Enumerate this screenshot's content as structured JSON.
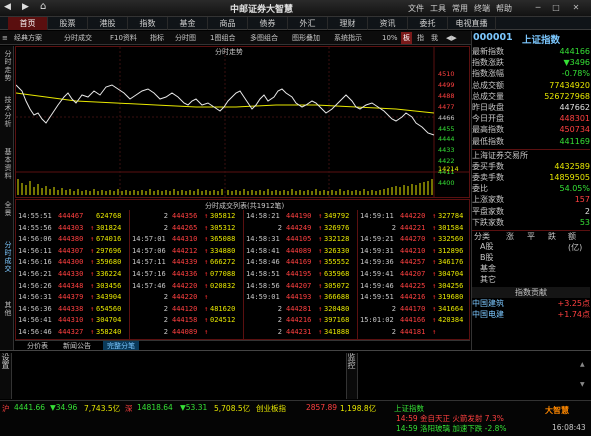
{
  "app": {
    "title": "中邮证券大智慧",
    "menus": [
      "文件",
      "工具",
      "常用",
      "终端",
      "帮助"
    ]
  },
  "navbar": {
    "tabs": [
      "首页",
      "股票",
      "港股",
      "指数",
      "基金",
      "商品",
      "债券",
      "外汇",
      "理财",
      "资讯",
      "委托",
      "电视直播"
    ]
  },
  "toolbar": {
    "items": [
      "经典方案",
      "分时成交",
      "F10资料",
      "指标",
      "分时图",
      "1图组合",
      "多图组合",
      "图形叠加",
      "系统指示",
      "10%"
    ],
    "toggles": [
      "板",
      "指",
      "我"
    ]
  },
  "lefttabs": [
    "分时走势",
    "技术分析",
    "基本资料",
    "全景",
    "分时成交",
    "其他"
  ],
  "chart": {
    "title": "分时走势",
    "price_labels": [
      "4510",
      "4499",
      "4488",
      "4477",
      "4466",
      "4455",
      "4444",
      "4433",
      "4422",
      "4411",
      "4400"
    ],
    "vol_label": "14214"
  },
  "trades": {
    "title": "分时成交列表(共1912笔)",
    "columns": [
      {
        "rows": [
          [
            "14:55:51",
            "444467",
            "624768",
            ""
          ],
          [
            "14:55:56",
            "444303",
            "301824",
            "up"
          ],
          [
            "14:56:06",
            "444380",
            "674016",
            "up"
          ],
          [
            "14:56:11",
            "444307",
            "297696",
            "up"
          ],
          [
            "14:56:16",
            "444300",
            "359680",
            "up"
          ],
          [
            "14:56:21",
            "444330",
            "336224",
            "up"
          ],
          [
            "14:56:26",
            "444348",
            "303456",
            "up"
          ],
          [
            "14:56:31",
            "444379",
            "343904",
            "up"
          ],
          [
            "14:56:36",
            "444338",
            "654560",
            "up"
          ],
          [
            "14:56:41",
            "444310",
            "304704",
            "up"
          ],
          [
            "14:56:46",
            "444327",
            "358240",
            "up"
          ]
        ]
      },
      {
        "rows": [
          [
            "2",
            "444356",
            "305812",
            "up"
          ],
          [
            "2",
            "444265",
            "305312",
            "up"
          ],
          [
            "14:57:01",
            "444310",
            "365088",
            "up"
          ],
          [
            "14:57:06",
            "444212",
            "334880",
            "up"
          ],
          [
            "14:57:11",
            "444339",
            "666272",
            "up"
          ],
          [
            "14:57:16",
            "444336",
            "077088",
            "up"
          ],
          [
            "14:57:46",
            "444220",
            "020832",
            "up"
          ],
          [
            "2",
            "444220",
            "",
            "up"
          ],
          [
            "2",
            "444120",
            "481620",
            "up"
          ],
          [
            "2",
            "444158",
            "024512",
            "up"
          ],
          [
            "2",
            "444089",
            "",
            "up"
          ]
        ]
      },
      {
        "rows": [
          [
            "14:58:21",
            "444190",
            "349792",
            "up"
          ],
          [
            "2",
            "444249",
            "326976",
            "up"
          ],
          [
            "14:58:31",
            "444105",
            "332128",
            "up"
          ],
          [
            "14:58:41",
            "444089",
            "326330",
            "up"
          ],
          [
            "14:58:46",
            "444169",
            "355552",
            "up"
          ],
          [
            "14:58:51",
            "444195",
            "635968",
            "up"
          ],
          [
            "14:58:56",
            "444207",
            "305072",
            "up"
          ],
          [
            "14:59:01",
            "444193",
            "366688",
            "up"
          ],
          [
            "2",
            "444281",
            "320480",
            "up"
          ],
          [
            "2",
            "444216",
            "397168",
            "up"
          ],
          [
            "2",
            "444231",
            "341888",
            "up"
          ]
        ]
      },
      {
        "rows": [
          [
            "14:59:11",
            "444220",
            "327784",
            "up"
          ],
          [
            "2",
            "444221",
            "301584",
            "up"
          ],
          [
            "14:59:21",
            "444270",
            "332560",
            "up"
          ],
          [
            "14:59:31",
            "444210",
            "312896",
            "up"
          ],
          [
            "14:59:36",
            "444257",
            "346176",
            "up"
          ],
          [
            "14:59:41",
            "444207",
            "304704",
            "up"
          ],
          [
            "14:59:46",
            "444225",
            "304256",
            "up"
          ],
          [
            "14:59:51",
            "444216",
            "319680",
            "up"
          ],
          [
            "2",
            "444170",
            "341664",
            "up"
          ],
          [
            "15:01:02",
            "444166",
            "420384",
            "up"
          ],
          [
            "2",
            "444181",
            "",
            "up"
          ]
        ]
      }
    ]
  },
  "bottomtabs": [
    "分价表",
    "新闻公告",
    "完整分笔"
  ],
  "quote": {
    "code": "000001",
    "name": "上证指数",
    "rows": [
      {
        "label": "最新指数",
        "value": "444166",
        "color": "#35e035"
      },
      {
        "label": "指数涨跌",
        "value": "▼3496",
        "color": "#35e035"
      },
      {
        "label": "指数涨幅",
        "value": "-0.78%",
        "color": "#35e035"
      },
      {
        "label": "总成交额",
        "value": "77434920",
        "color": "#e8e800"
      },
      {
        "label": "总成交量",
        "value": "526727968",
        "color": "#e8e800"
      },
      {
        "label": "昨日收盘",
        "value": "447662",
        "color": "#e0e0e0"
      },
      {
        "label": "今日开盘",
        "value": "448301",
        "color": "#ff4040"
      },
      {
        "label": "最高指数",
        "value": "450734",
        "color": "#ff4040"
      },
      {
        "label": "最低指数",
        "value": "441169",
        "color": "#35e035"
      }
    ],
    "exchange_title": "上海证券交易所",
    "exchange_rows": [
      {
        "label": "委买手数",
        "value": "4432589",
        "color": "#e8e800"
      },
      {
        "label": "委卖手数",
        "value": "14859505",
        "color": "#e8e800"
      },
      {
        "label": "委比",
        "value": "54.05%",
        "color": "#35e035"
      },
      {
        "label": "上涨家数",
        "value": "157",
        "color": "#ff4040"
      },
      {
        "label": "平盘家数",
        "value": "2",
        "color": "#e0e0e0"
      },
      {
        "label": "下跌家数",
        "value": "53",
        "color": "#35e035"
      }
    ],
    "table_header": [
      "分类",
      "涨",
      "平",
      "跌",
      "额(亿)"
    ],
    "table_rows": [
      "A股",
      "B股",
      "基金",
      "其它"
    ],
    "contrib_title": "指数贡献",
    "contrib_rows": [
      {
        "label": "中国建筑",
        "value": "+3.25点",
        "color": "#ff4040"
      },
      {
        "label": "中国电建",
        "value": "+1.74点",
        "color": "#ff4040"
      }
    ]
  },
  "subpanel": {
    "left_label": "设置",
    "mid_label": "监控"
  },
  "status": {
    "sh_label": "沪",
    "sh_value": "4441.66",
    "sh_chg": "▼34.96",
    "sh_amt": "7,743.5亿",
    "sz_label": "深",
    "sz_value": "14818.64",
    "sz_chg": "▼53.31",
    "sz_amt": "5,708.5亿",
    "cy_label": "创业板指",
    "cy_value": "2857.89",
    "cy_amt": "1,198.8亿",
    "mid_label": "上证指数",
    "news1": "14:59 金自天正 火箭发射 7.3%",
    "news2": "14:59 洛阳玻璃 加速下跌 -2.8%",
    "logo": "大智慧",
    "clock": "16:08:43"
  },
  "colors": {
    "up": "#ff4040",
    "down": "#35e035",
    "vol": "#e8e800",
    "border": "#5a1010"
  }
}
